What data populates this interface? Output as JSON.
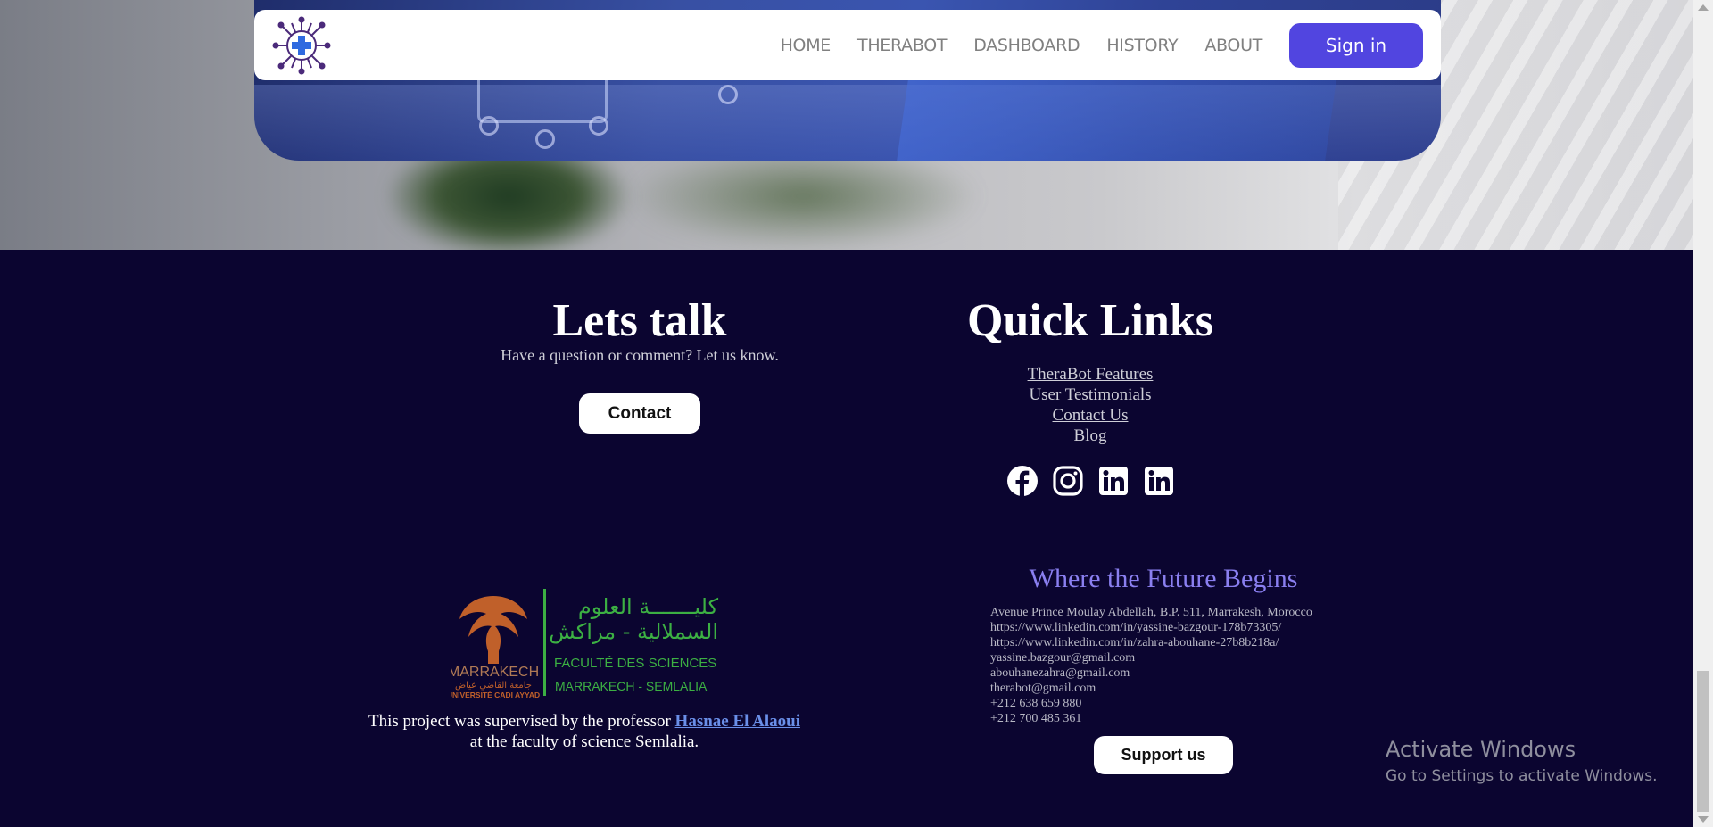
{
  "nav": {
    "links": [
      "HOME",
      "THERABOT",
      "DASHBOARD",
      "HISTORY",
      "ABOUT"
    ],
    "signin_label": "Sign in"
  },
  "footer": {
    "lets_talk": {
      "title": "Lets talk",
      "subtitle": "Have a question or comment? Let us know.",
      "button": "Contact"
    },
    "quick_links": {
      "title": "Quick Links",
      "items": [
        "TheraBot Features",
        "User Testimonials",
        "Contact Us",
        "Blog"
      ],
      "socials": [
        "facebook-icon",
        "instagram-icon",
        "linkedin-icon",
        "linkedin-icon"
      ]
    },
    "faculty_logo": {
      "arabic_line1": "كليـــــــة العلوم",
      "arabic_line2": "السملالية - مراكش",
      "french_line": "FACULTÉ DES SCIENCES",
      "city_line": "MARRAKECH  -  SEMLALIA",
      "emblem_city": "MARRAKECH",
      "university_arabic": "جامعة القاضي عياض",
      "university_french": "UNIVERSITÉ CADI AYYAD"
    },
    "supervised": {
      "prefix": "This project was supervised by the professor ",
      "name": "Hasnae El Alaoui",
      "suffix": "at the faculty of science Semlalia."
    },
    "contact_info": {
      "heading": "Where the Future Begins",
      "lines": [
        "Avenue Prince Moulay Abdellah, B.P. 511, Marrakesh, Morocco",
        "https://www.linkedin.com/in/yassine-bazgour-178b73305/",
        "https://www.linkedin.com/in/zahra-abouhane-27b8b218a/",
        "yassine.bazgour@gmail.com",
        "abouhanezahra@gmail.com",
        "therabot@gmail.com",
        "+212 638 659 880",
        "+212 700 485 361"
      ],
      "button": "Support us"
    }
  },
  "watermark": {
    "title": "Activate Windows",
    "subtitle": "Go to Settings to activate Windows."
  },
  "colors": {
    "footer_bg": "#0b0530",
    "accent": "#5145e0",
    "heading_purple": "#8a7ff0",
    "link_blue": "#6a8fe8",
    "faculty_green": "#3cb043",
    "emblem_orange": "#c0602a"
  }
}
